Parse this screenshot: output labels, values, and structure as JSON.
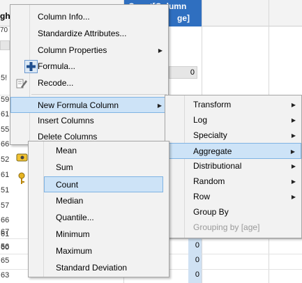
{
  "table": {
    "left_col_header": "ght",
    "count_col_header_line1": "Count[Column",
    "count_col_header_line2": "ge]",
    "top_left_value": "70",
    "left_col_values": [
      "5!",
      "59",
      "61",
      "55",
      "66",
      "52",
      "61",
      "51",
      "57",
      "66",
      "67",
      "60",
      "61",
      "56",
      "65",
      "63"
    ],
    "count_box_value": "0",
    "count_values": [
      "0",
      "0",
      "0",
      "0"
    ]
  },
  "menu_main": {
    "items": [
      {
        "label": "Column Info...",
        "icon": null,
        "submenu": false
      },
      {
        "label": "Standardize Attributes...",
        "icon": null,
        "submenu": false
      },
      {
        "label": "Column Properties",
        "icon": null,
        "submenu": true
      },
      {
        "label": "Formula...",
        "icon": "formula-plus-icon",
        "submenu": false
      },
      {
        "label": "Recode...",
        "icon": "recode-pencil-icon",
        "submenu": false
      },
      {
        "label": "New Formula Column",
        "icon": null,
        "submenu": true,
        "highlighted": true
      },
      {
        "label": "Insert Columns",
        "icon": null,
        "submenu": false
      },
      {
        "label": "Delete Columns",
        "icon": null,
        "submenu": false
      }
    ],
    "hidden_icons": [
      "hide-eye-icon",
      "label-key-icon"
    ]
  },
  "menu_formula": {
    "items": [
      {
        "label": "Transform",
        "submenu": true
      },
      {
        "label": "Log",
        "submenu": true
      },
      {
        "label": "Specialty",
        "submenu": true
      },
      {
        "label": "Aggregate",
        "submenu": true,
        "highlighted": true
      },
      {
        "label": "Distributional",
        "submenu": true
      },
      {
        "label": "Random",
        "submenu": true
      },
      {
        "label": "Row",
        "submenu": true
      },
      {
        "label": "Group By",
        "submenu": false
      },
      {
        "label": "Grouping by [age]",
        "submenu": false,
        "disabled": true
      }
    ]
  },
  "menu_aggregate": {
    "items": [
      {
        "label": "Mean"
      },
      {
        "label": "Sum"
      },
      {
        "label": "Count",
        "highlighted": true
      },
      {
        "label": "Median"
      },
      {
        "label": "Quantile..."
      },
      {
        "label": "Minimum"
      },
      {
        "label": "Maximum"
      },
      {
        "label": "Standard Deviation"
      }
    ]
  },
  "colors": {
    "menu_bg": "#f2f2f2",
    "highlight_bg": "#cde3f7",
    "highlight_border": "#7fb3e3",
    "column_header_accent": "#2f6fc0",
    "selected_column_fill": "#cfe1f3"
  }
}
